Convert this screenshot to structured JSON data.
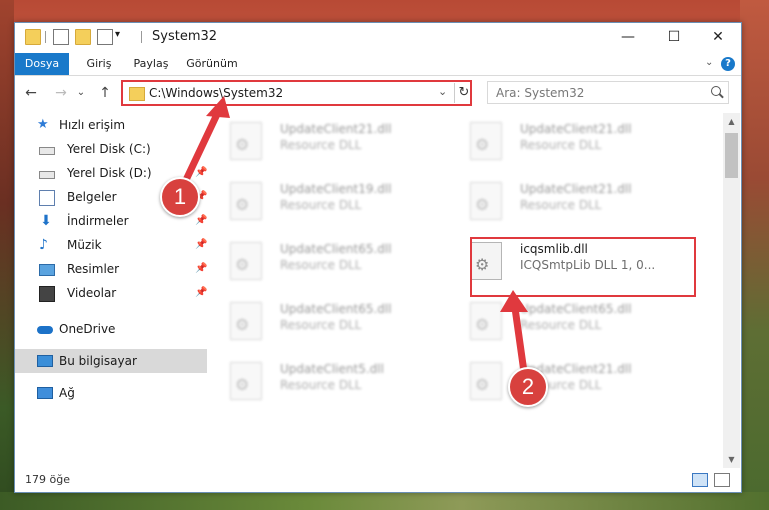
{
  "window": {
    "title": "System32",
    "quick_access_chevron": "▾",
    "controls": {
      "minimize": "—",
      "maximize": "☐",
      "close": "✕"
    }
  },
  "ribbon": {
    "tabs": [
      "Dosya",
      "Giriş",
      "Paylaş",
      "Görünüm"
    ],
    "expand": "⌄",
    "help": "?"
  },
  "navigation": {
    "back": "←",
    "forward": "→",
    "recent": "⌄",
    "up": "↑",
    "address_path": "C:\\Windows\\System32",
    "address_dropdown": "⌄",
    "refresh": "↻",
    "search_placeholder": "Ara: System32"
  },
  "sidebar": {
    "items": [
      {
        "label": "Hızlı erişim",
        "icon": "star-icon",
        "pinned": false
      },
      {
        "label": "Yerel Disk (C:)",
        "icon": "drive-icon",
        "pinned": false
      },
      {
        "label": "Yerel Disk (D:)",
        "icon": "drive-icon",
        "pinned": true
      },
      {
        "label": "Belgeler",
        "icon": "documents-icon",
        "pinned": true
      },
      {
        "label": "İndirmeler",
        "icon": "downloads-icon",
        "pinned": true
      },
      {
        "label": "Müzik",
        "icon": "music-icon",
        "pinned": true
      },
      {
        "label": "Resimler",
        "icon": "pictures-icon",
        "pinned": true
      },
      {
        "label": "Videolar",
        "icon": "videos-icon",
        "pinned": true
      },
      {
        "label": "OneDrive",
        "icon": "onedrive-icon",
        "pinned": false
      },
      {
        "label": "Bu bilgisayar",
        "icon": "computer-icon",
        "pinned": false,
        "selected": true
      },
      {
        "label": "Ağ",
        "icon": "network-icon",
        "pinned": false
      }
    ],
    "pin_glyph": "📌"
  },
  "files": [
    {
      "name": "UpdateClient21.dll",
      "desc": "Resource DLL"
    },
    {
      "name": "UpdateClient21.dll",
      "desc": "Resource DLL"
    },
    {
      "name": "UpdateClient19.dll",
      "desc": "Resource DLL"
    },
    {
      "name": "UpdateClient21.dll",
      "desc": "Resource DLL"
    },
    {
      "name": "UpdateClient65.dll",
      "desc": "Resource DLL"
    },
    {
      "name": "icqsmlib.dll",
      "desc": "ICQSmtpLib DLL 1, 0...",
      "highlighted": true
    },
    {
      "name": "UpdateClient65.dll",
      "desc": "Resource DLL"
    },
    {
      "name": "UpdateClient65.dll",
      "desc": "Resource DLL"
    },
    {
      "name": "UpdateClient5.dll",
      "desc": "Resource DLL"
    },
    {
      "name": "UpdateClient21.dll",
      "desc": "Resource DLL"
    }
  ],
  "status": {
    "item_count": "179 öğe"
  },
  "callouts": {
    "step1": "1",
    "step2": "2"
  },
  "colors": {
    "accent": "#1979ca",
    "highlight": "#e0393e",
    "callout": "#d8413e"
  }
}
